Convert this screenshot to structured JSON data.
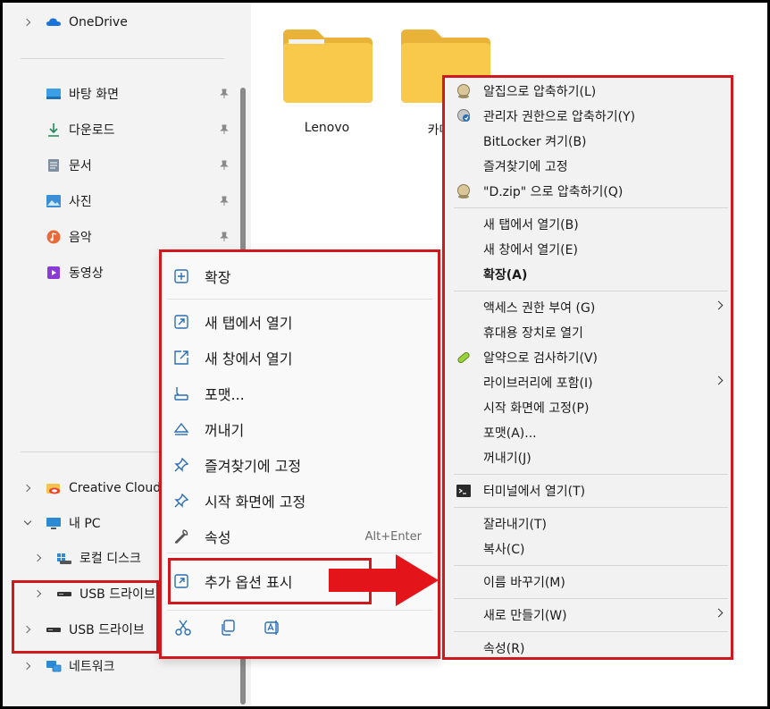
{
  "nav": {
    "onedrive": "OneDrive",
    "quick": [
      {
        "label": "바탕 화면",
        "icon": "desktop-icon"
      },
      {
        "label": "다운로드",
        "icon": "download-icon"
      },
      {
        "label": "문서",
        "icon": "document-icon"
      },
      {
        "label": "사진",
        "icon": "pictures-icon"
      },
      {
        "label": "음악",
        "icon": "music-icon"
      },
      {
        "label": "동영상",
        "icon": "video-icon"
      }
    ],
    "creative_cloud": "Creative Cloud",
    "this_pc": "내 PC",
    "local_disk": "로컬 디스크",
    "usb1": "USB 드라이브",
    "usb2": "USB 드라이브",
    "network": "네트워크"
  },
  "folders": [
    {
      "name": "Lenovo"
    },
    {
      "name": "카메라"
    }
  ],
  "menu1": {
    "expand": "확장",
    "open_new_tab": "새 탭에서 열기",
    "open_new_window": "새 창에서 열기",
    "format": "포맷...",
    "eject": "꺼내기",
    "pin_quick": "즐겨찾기에 고정",
    "pin_start": "시작 화면에 고정",
    "properties": "속성",
    "properties_shortcut": "Alt+Enter",
    "more_options": "추가 옵션 표시"
  },
  "menu2": {
    "items_group1": [
      {
        "label": "알집으로 압축하기(L)",
        "icon": "alzip-icon"
      },
      {
        "label": "관리자 권한으로 압축하기(Y)",
        "icon": "alzip-admin-icon"
      },
      {
        "label": "BitLocker 켜기(B)",
        "icon": ""
      },
      {
        "label": "즐겨찾기에 고정",
        "icon": ""
      },
      {
        "label": "\"D.zip\" 으로 압축하기(Q)",
        "icon": "alzip-icon"
      }
    ],
    "items_group2": [
      {
        "label": "새 탭에서 열기(B)"
      },
      {
        "label": "새 창에서 열기(E)"
      },
      {
        "label": "확장(A)"
      }
    ],
    "items_group3": [
      {
        "label": "액세스 권한 부여 (G)",
        "submenu": true
      },
      {
        "label": "휴대용 장치로 열기"
      },
      {
        "label": "알약으로 검사하기(V)",
        "icon": "alyac-icon"
      },
      {
        "label": "라이브러리에 포함(I)",
        "submenu": true
      },
      {
        "label": "시작 화면에 고정(P)"
      },
      {
        "label": "포맷(A)..."
      },
      {
        "label": "꺼내기(J)"
      }
    ],
    "terminal": "터미널에서 열기(T)",
    "cut": "잘라내기(T)",
    "copy": "복사(C)",
    "rename": "이름 바꾸기(M)",
    "new": "새로 만들기(W)",
    "properties": "속성(R)"
  },
  "colors": {
    "highlight_red": "#d0191f",
    "folder_yellow": "#f8c94a"
  }
}
